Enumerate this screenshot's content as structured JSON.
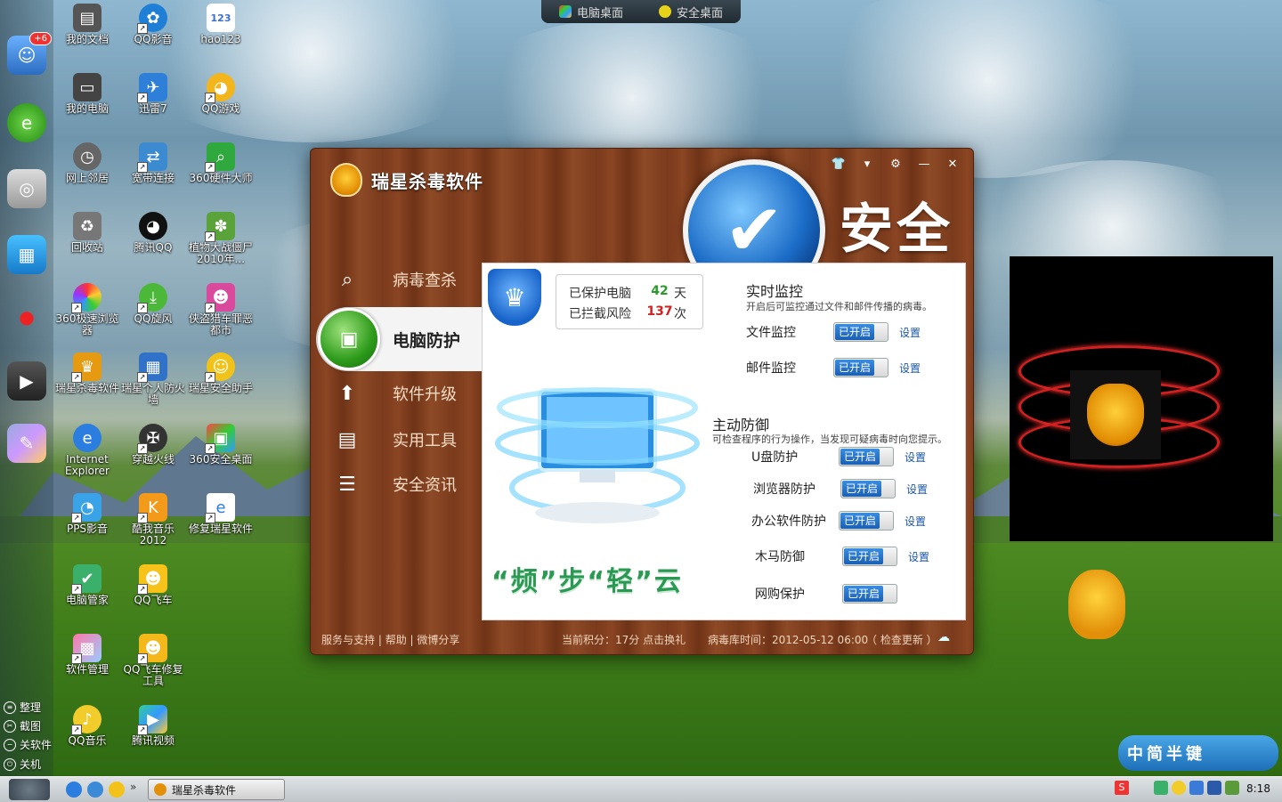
{
  "switcher": {
    "pc_desktop": "电脑桌面",
    "safe_desktop": "安全桌面"
  },
  "quickbar": {
    "badge": "+6",
    "bottom": [
      "整理",
      "截图",
      "关软件",
      "关机"
    ]
  },
  "desktop_icons": [
    {
      "label": "我的文档"
    },
    {
      "label": "QQ影音"
    },
    {
      "label": "hao123"
    },
    {
      "label": "我的电脑"
    },
    {
      "label": "迅雷7"
    },
    {
      "label": "QQ游戏"
    },
    {
      "label": "网上邻居"
    },
    {
      "label": "宽带连接"
    },
    {
      "label": "360硬件大师"
    },
    {
      "label": "回收站"
    },
    {
      "label": "腾讯QQ"
    },
    {
      "label": "植物大战僵尸2010年..."
    },
    {
      "label": "360极速浏览器"
    },
    {
      "label": "QQ旋风"
    },
    {
      "label": "侠盗猎车罪恶都市"
    },
    {
      "label": "瑞星杀毒软件"
    },
    {
      "label": "瑞星个人防火墙"
    },
    {
      "label": "瑞星安全助手"
    },
    {
      "label": "Internet Explorer"
    },
    {
      "label": "穿越火线"
    },
    {
      "label": "360安全桌面"
    },
    {
      "label": "PPS影音"
    },
    {
      "label": "酷我音乐2012"
    },
    {
      "label": "修复瑞星软件"
    },
    {
      "label": "电脑管家"
    },
    {
      "label": "QQ飞车"
    },
    {
      "label": "软件管理"
    },
    {
      "label": "QQ飞车修复工具"
    },
    {
      "label": "QQ音乐"
    },
    {
      "label": "腾讯视频"
    }
  ],
  "window": {
    "title": "瑞星杀毒软件",
    "status": "安全",
    "nav": [
      "病毒查杀",
      "电脑防护",
      "软件升级",
      "实用工具",
      "安全资讯"
    ],
    "stats": {
      "protected_label": "已保护电脑",
      "protected_value": "42",
      "protected_unit": "天",
      "blocked_label": "已拦截风险",
      "blocked_value": "137",
      "blocked_unit": "次"
    },
    "realtime": {
      "title": "实时监控",
      "desc": "开启后可监控通过文件和邮件传播的病毒。",
      "items": [
        {
          "name": "文件监控"
        },
        {
          "name": "邮件监控"
        }
      ]
    },
    "active": {
      "title": "主动防御",
      "desc": "可检查程序的行为操作，当发现可疑病毒时向您提示。",
      "items": [
        {
          "name": "U盘防护"
        },
        {
          "name": "浏览器防护"
        },
        {
          "name": "办公软件防护"
        },
        {
          "name": "木马防御"
        },
        {
          "name": "网购保护"
        }
      ]
    },
    "toggle_on": "已开启",
    "setting": "设置",
    "slogan": "“频”步“轻”云",
    "footer": {
      "support": "服务与支持",
      "help": "帮助",
      "weibo": "微博分享",
      "points": "当前积分：17分 点击换礼",
      "db_time": "病毒库时间：2012-05-12 06:00",
      "update": "（ 检查更新 ）"
    }
  },
  "taskbar": {
    "task": "瑞星杀毒软件",
    "clock": "8:18"
  },
  "input_method": "中简半键"
}
